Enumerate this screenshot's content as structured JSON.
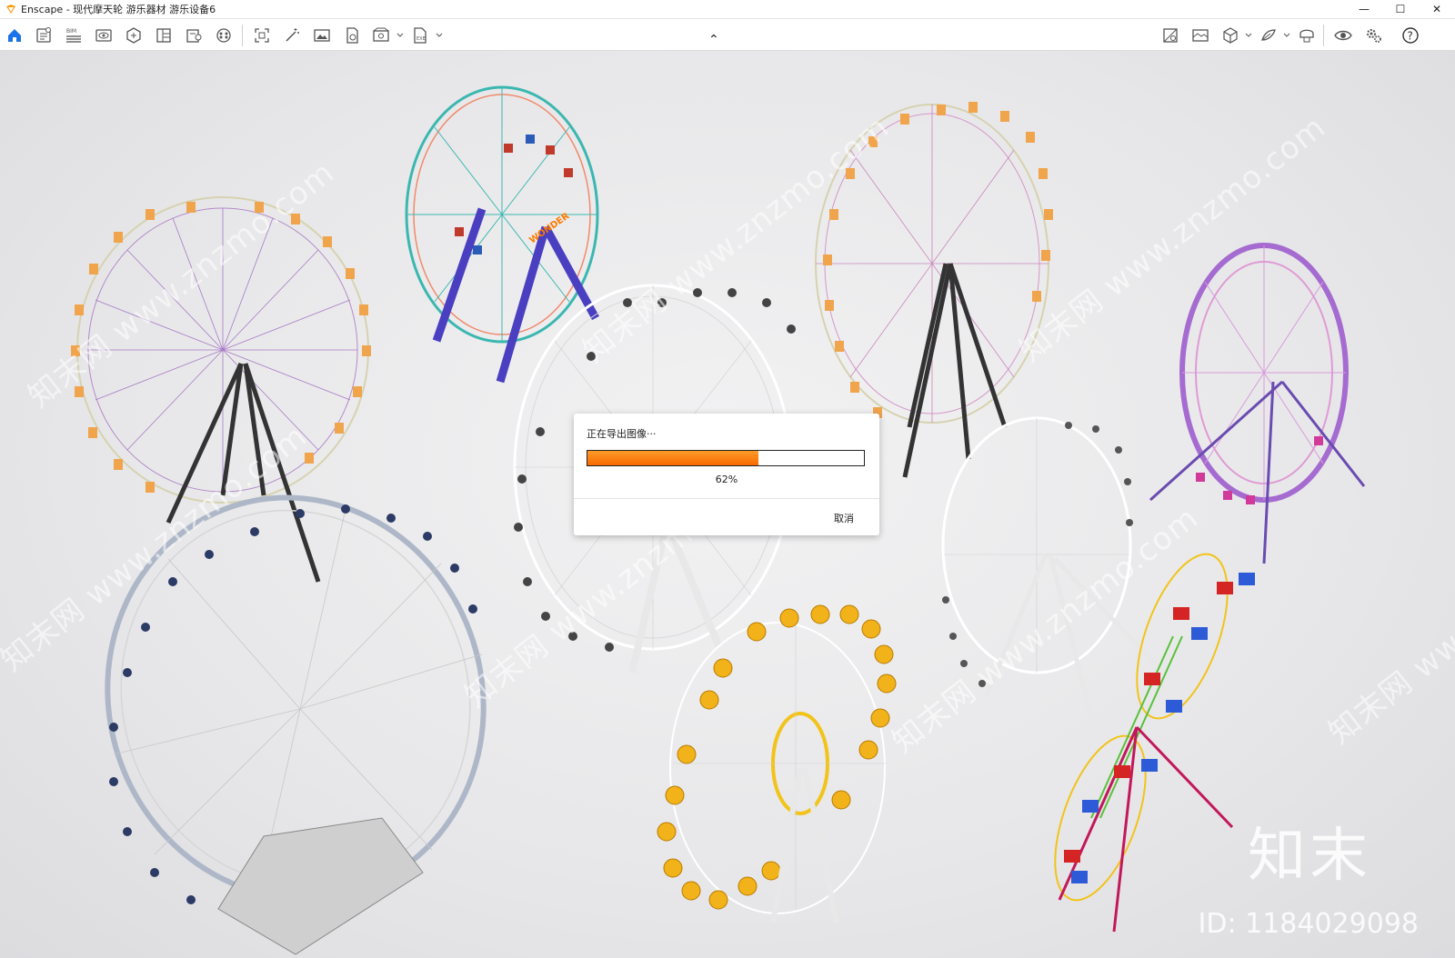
{
  "window": {
    "title": "Enscape - 现代摩天轮 游乐器材 游乐设备6",
    "minimize_glyph": "—",
    "maximize_glyph": "☐",
    "close_glyph": "✕"
  },
  "toolbar": {
    "bim_label": "BIM",
    "collapse_glyph": "⌃",
    "left_icons": [
      "home-icon",
      "project-file-icon",
      "bim-icon",
      "visual-settings-icon",
      "asset-library-icon",
      "views-icon",
      "materials-icon",
      "vr-icon"
    ],
    "export_icons": [
      "screenshot-icon",
      "batch-render-icon",
      "image-export-icon",
      "panorama-icon",
      "video-export-icon",
      "standalone-export-icon"
    ],
    "right_icons": [
      "material-editor-icon",
      "site-context-icon",
      "sketchup-sync-icon",
      "live-update-icon",
      "vr-headset-icon",
      "view-toggle-icon",
      "settings-icon",
      "help-icon"
    ],
    "accent_color": "#1a73e8"
  },
  "export_dialog": {
    "title": "正在导出图像···",
    "progress_percent": 62,
    "progress_label": "62%",
    "cancel_label": "取消",
    "progress_color": "#f76a00"
  },
  "watermark": {
    "site_text": "知末网 www.znzmo.com",
    "brand_text": "知末",
    "id_text": "ID: 1184029098"
  }
}
